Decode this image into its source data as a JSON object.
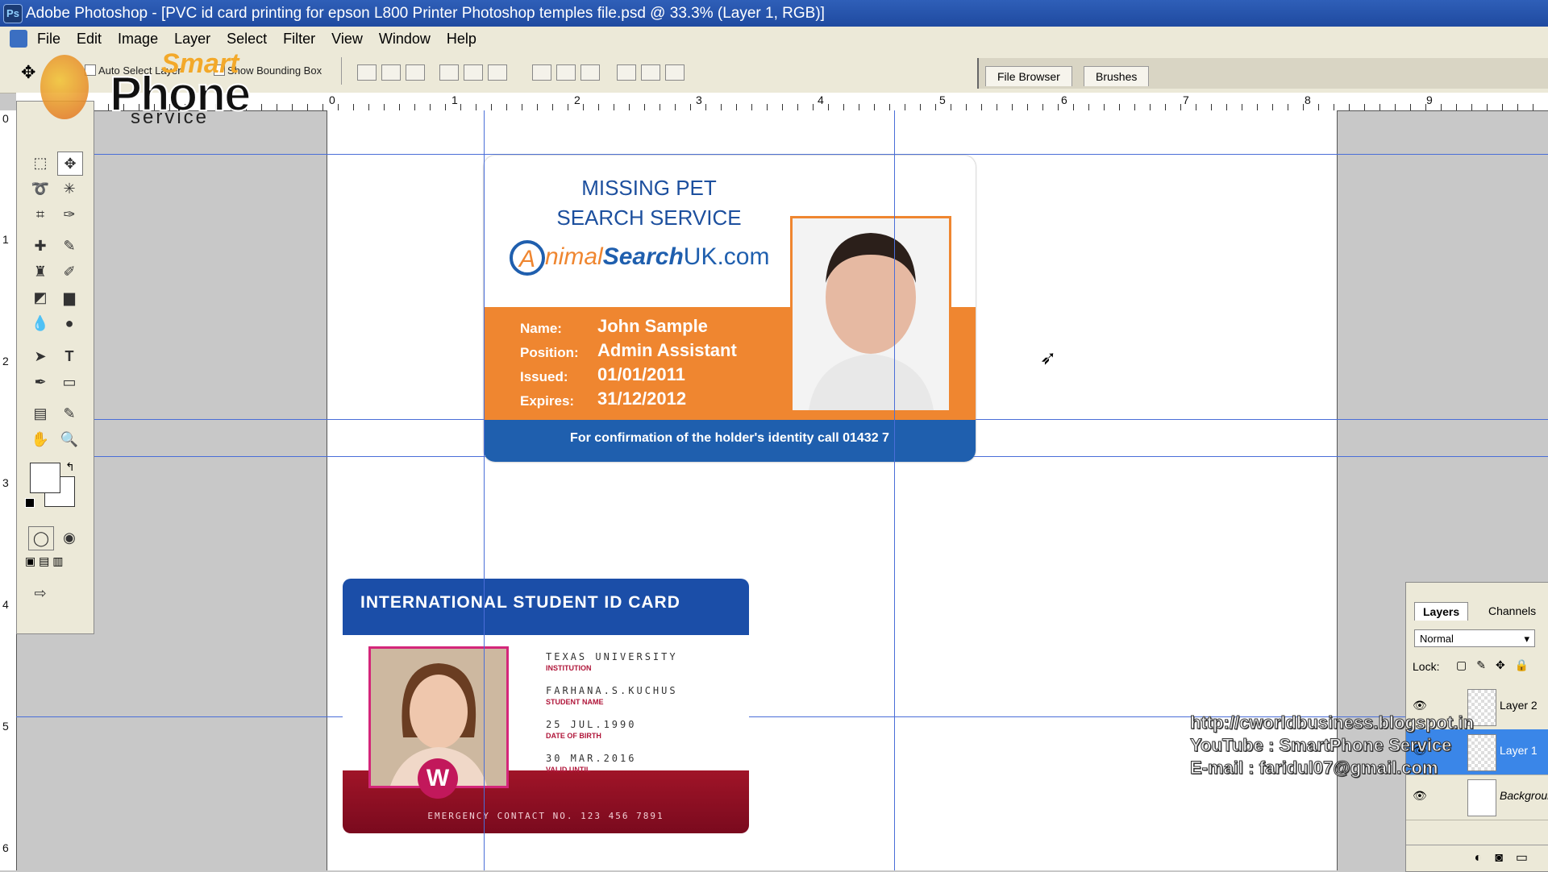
{
  "window": {
    "title": "Adobe Photoshop - [PVC id card printing  for epson L800 Printer Photoshop temples file.psd @ 33.3% (Layer 1, RGB)]"
  },
  "menu": [
    "File",
    "Edit",
    "Image",
    "Layer",
    "Select",
    "Filter",
    "View",
    "Window",
    "Help"
  ],
  "options": {
    "auto_select": "Auto Select Layer",
    "bounding_box": "Show Bounding Box"
  },
  "palette_tabs": [
    "File Browser",
    "Brushes"
  ],
  "ruler": {
    "h": [
      "0",
      "1",
      "2",
      "3",
      "4",
      "5",
      "6",
      "7",
      "8",
      "9"
    ],
    "v": [
      "0",
      "1",
      "2",
      "3",
      "4",
      "5",
      "6"
    ]
  },
  "logo": {
    "line1": "Smart",
    "line2": "Phone",
    "line3": "service"
  },
  "card1": {
    "title_line1": "MISSING PET",
    "title_line2": "SEARCH SERVICE",
    "brand_a": "A",
    "brand_b": "nimal",
    "brand_c": "Search",
    "brand_d": "UK.com",
    "fields": [
      {
        "label": "Name:",
        "value": "John Sample"
      },
      {
        "label": "Position:",
        "value": "Admin Assistant"
      },
      {
        "label": "Issued:",
        "value": "01/01/2011"
      },
      {
        "label": "Expires:",
        "value": "31/12/2012"
      }
    ],
    "footer": "For confirmation of the holder's identity call 01432 7"
  },
  "card2": {
    "header": "INTERNATIONAL STUDENT ID CARD",
    "rows": [
      {
        "value": "TEXAS UNIVERSITY",
        "label": "INSTITUTION"
      },
      {
        "value": "FARHANA.S.KUCHUS",
        "label": "STUDENT NAME"
      },
      {
        "value": "25 JUL.1990",
        "label": "DATE OF BIRTH"
      },
      {
        "value": "30 MAR.2016",
        "label": "VALID UNTIL"
      }
    ],
    "footer": "EMERGENCY CONTACT NO. 123 456 7891",
    "badge": "W"
  },
  "layers_panel": {
    "tabs": [
      "Layers",
      "Channels"
    ],
    "blend_mode": "Normal",
    "lock_label": "Lock:",
    "layers": [
      {
        "name": "Layer 2",
        "visible": true,
        "selected": false
      },
      {
        "name": "Layer 1",
        "visible": true,
        "selected": true
      },
      {
        "name": "Background",
        "visible": true,
        "selected": false
      }
    ]
  },
  "watermark": {
    "line1": "http://cworldbusiness.blogspot.in",
    "line2": "YouTube : SmartPhone Service",
    "line3": "E-mail : faridul07@gmail.com"
  },
  "colors": {
    "accent_orange": "#ef8630",
    "card_blue": "#1f5fae",
    "guide": "#4a6ed8",
    "selected_layer": "#3a86e8"
  }
}
